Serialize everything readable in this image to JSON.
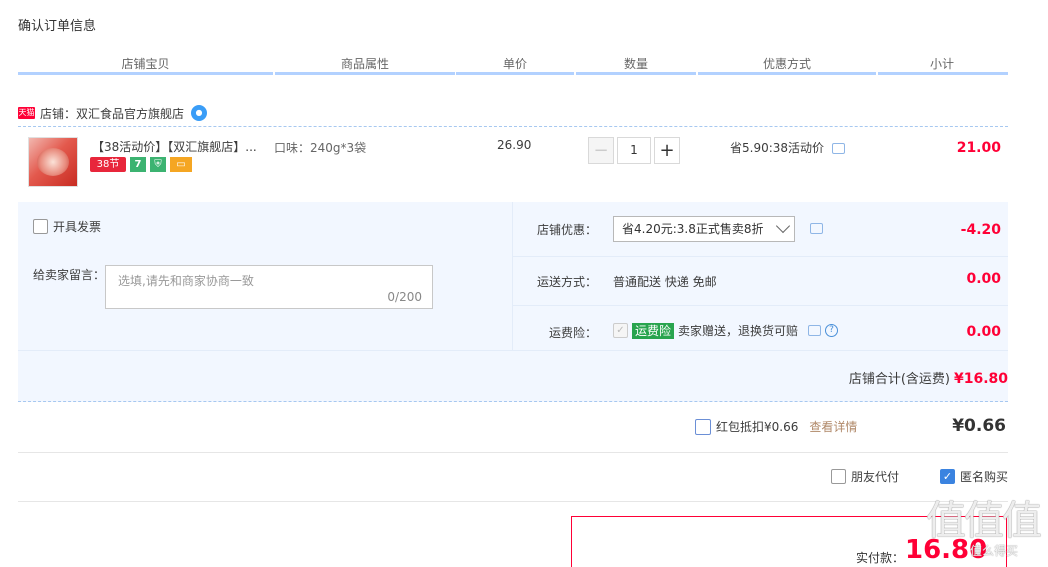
{
  "page_title": "确认订单信息",
  "columns": [
    "店铺宝贝",
    "商品属性",
    "单价",
    "数量",
    "优惠方式",
    "小计"
  ],
  "shop": {
    "badge": "天猫",
    "name": "店铺：双汇食品官方旗舰店",
    "ww_icon": "chat-bubble-icon"
  },
  "item": {
    "title": "【38活动价】【双汇旗舰店】...",
    "tags": [
      "38节",
      "7",
      "shield",
      "card"
    ],
    "attribute": "口味：240g*3袋",
    "price": "26.90",
    "quantity": "1",
    "minus_label": "−",
    "plus_label": "+",
    "discount": "省5.90:38活动价",
    "subtotal": "21.00"
  },
  "invoice": {
    "label": "开具发票"
  },
  "message": {
    "label": "给卖家留言：",
    "placeholder": "选填,请先和商家协商一致",
    "counter": "0/200"
  },
  "shop_discount": {
    "label": "店铺优惠：",
    "selected": "省4.20元:3.8正式售卖8折",
    "value": "-4.20"
  },
  "shipping": {
    "label": "运送方式：",
    "value_text": "普通配送 快递 免邮",
    "value": "0.00"
  },
  "insurance": {
    "label": "运费险：",
    "badge": "运费险",
    "text": "卖家赠送，退换货可赔",
    "value": "0.00"
  },
  "shop_total": {
    "label": "店铺合计(含运费)",
    "value": "¥16.80"
  },
  "redpack": {
    "label": "红包抵扣¥0.66",
    "link": "查看详情",
    "value": "¥0.66"
  },
  "friend_pay": {
    "label": "朋友代付"
  },
  "anonymous": {
    "label": "匿名购买"
  },
  "payment": {
    "label": "实付款：",
    "value": "16.80"
  },
  "watermark": {
    "text": "值值值",
    "sub": "值么得买"
  },
  "colors": {
    "accent_red": "#ff0036",
    "header_line": "#b2d1ff",
    "block_bg": "#f2f7ff"
  }
}
